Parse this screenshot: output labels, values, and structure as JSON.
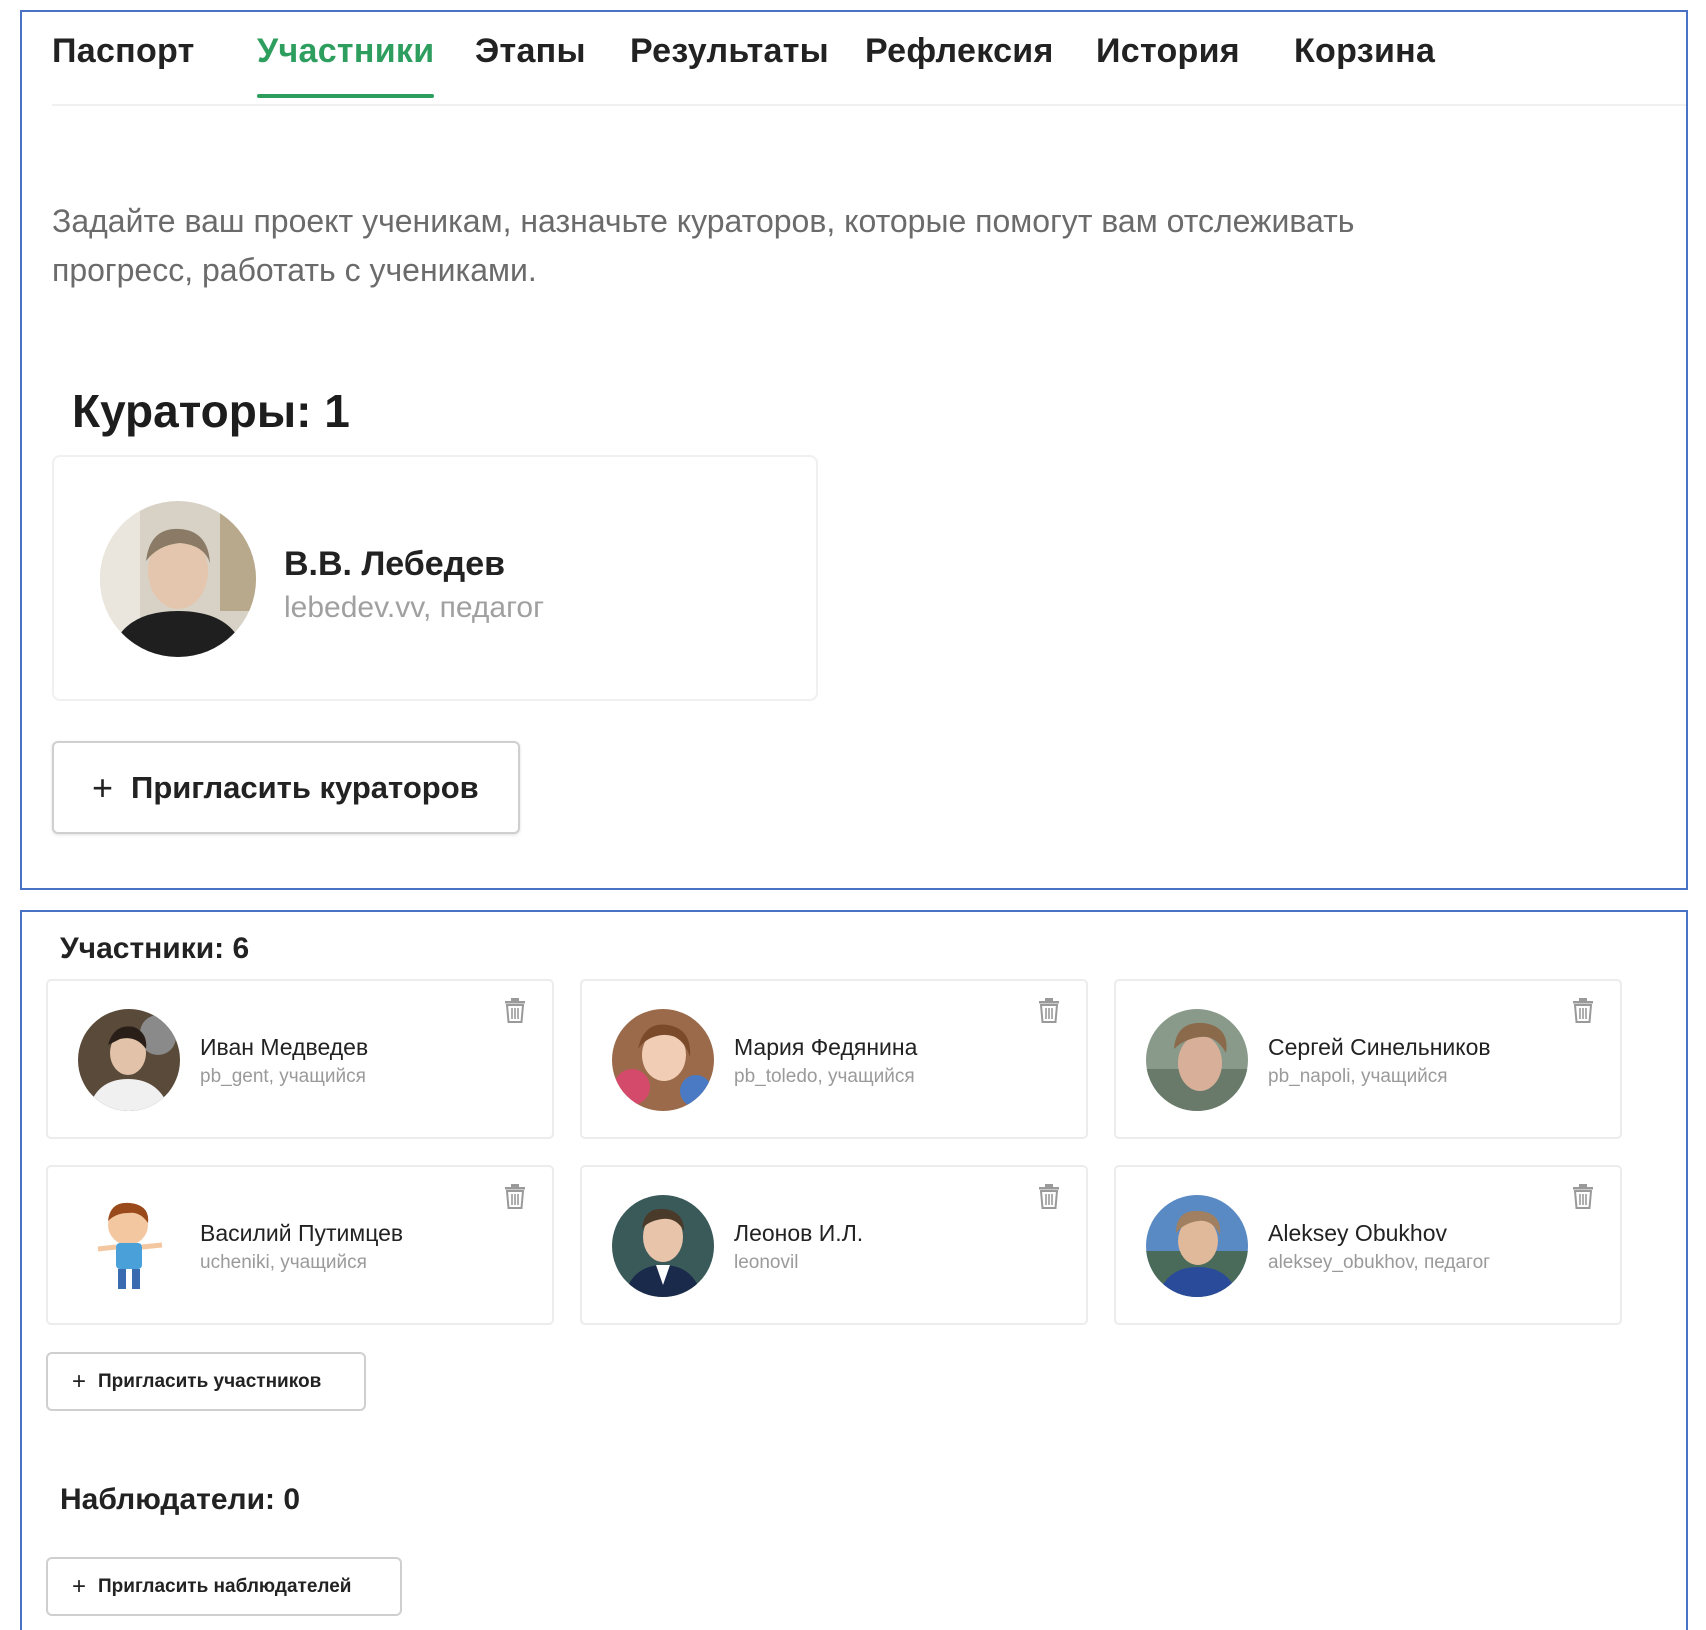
{
  "tabs": [
    {
      "label": "Паспорт"
    },
    {
      "label": "Участники",
      "active": true
    },
    {
      "label": "Этапы"
    },
    {
      "label": "Результаты"
    },
    {
      "label": "Рефлексия"
    },
    {
      "label": "История"
    },
    {
      "label": "Корзина"
    }
  ],
  "intro_text": "Задайте ваш проект ученикам, назначьте кураторов, которые помогут вам отслеживать прогресс, работать с учениками.",
  "curators": {
    "heading": "Кураторы: 1",
    "card": {
      "name": "В.В. Лебедев",
      "role": "lebedev.vv, педагог"
    },
    "invite_label": "Пригласить кураторов"
  },
  "participants": {
    "heading": "Участники: 6",
    "members": [
      {
        "name": "Иван Медведев",
        "role": "pb_gent, учащийся"
      },
      {
        "name": "Мария Федянина",
        "role": "pb_toledo, учащийся"
      },
      {
        "name": "Сергей Синельников",
        "role": "pb_napoli, учащийся"
      },
      {
        "name": "Василий Путимцев",
        "role": "ucheniki, учащийся"
      },
      {
        "name": "Леонов И.Л.",
        "role": "leonovil"
      },
      {
        "name": "Aleksey Obukhov",
        "role": "aleksey_obukhov, педагог"
      }
    ],
    "invite_label": "Пригласить участников"
  },
  "observers": {
    "heading": "Наблюдатели: 0",
    "invite_label": "Пригласить наблюдателей"
  },
  "plus_symbol": "+",
  "colors": {
    "accent": "#2e9e5e",
    "panel_border": "#4a72c4",
    "muted_text": "#9a9a9a"
  }
}
